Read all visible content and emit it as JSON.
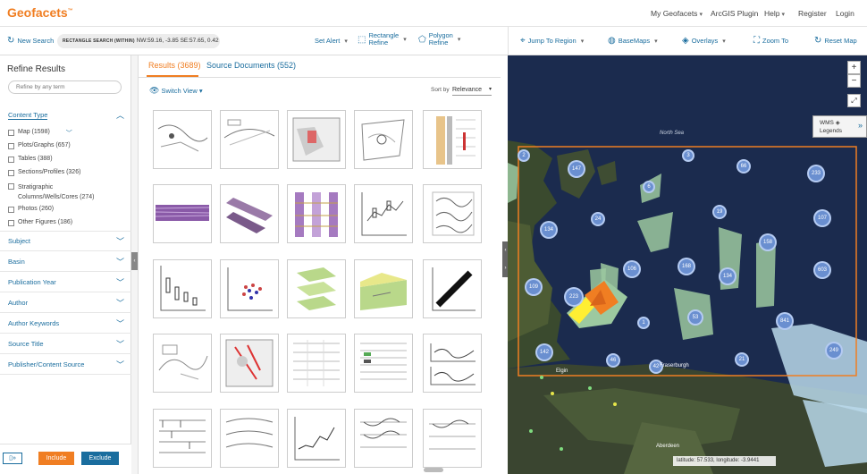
{
  "topbar": {
    "logo": "Geofacets",
    "logo_tm": "™",
    "my_geofacets": "My Geofacets",
    "arcgis": "ArcGIS Plugin",
    "help": "Help",
    "register": "Register",
    "login": "Login"
  },
  "toolbar": {
    "new_search": "New Search",
    "coord_prefix": "RECTANGLE SEARCH (WITHIN)",
    "coord_value": "NW:59.16, -3.85 SE:57.65, 0.42",
    "set_alert": "Set Alert",
    "rect_refine_1": "Rectangle",
    "rect_refine_2": "Refine",
    "poly_refine_1": "Polygon",
    "poly_refine_2": "Refine",
    "jump_region": "Jump To Region",
    "basemaps": "BaseMaps",
    "overlays": "Overlays",
    "zoom_to": "Zoom To",
    "reset_map": "Reset Map"
  },
  "refine": {
    "title": "Refine Results",
    "search_placeholder": "Refine by any term",
    "content_type": "Content Type",
    "facets": [
      "Map (1598)",
      "Plots/Graphs (657)",
      "Tables (388)",
      "Sections/Profiles (326)",
      "Stratigraphic",
      "Columns/Wells/Cores (274)",
      "Photos (260)",
      "Other Figures (186)"
    ],
    "sections": [
      "Subject",
      "Basin",
      "Publication Year",
      "Author",
      "Author Keywords",
      "Source Title",
      "Publisher/Content Source"
    ],
    "include": "Include",
    "exclude": "Exclude"
  },
  "results": {
    "tab_results": "Results (3689)",
    "tab_source": "Source Documents (552)",
    "switch_view": "Switch View",
    "sort_by": "Sort by",
    "sort_value": "Relevance"
  },
  "map": {
    "wms_1": "WMS",
    "wms_2": "Legends",
    "north_sea": "North Sea",
    "fraserburgh": "Fraserburgh",
    "elgin": "Elgin",
    "aberdeen": "Aberdeen",
    "latlon": "latitude: 57.533, longitude: -3.9441",
    "clusters": [
      "2",
      "147",
      "3",
      "66",
      "233",
      "6",
      "24",
      "19",
      "107",
      "134",
      "158",
      "106",
      "168",
      "134",
      "603",
      "109",
      "223",
      "53",
      "841",
      "1",
      "142",
      "46",
      "42",
      "21",
      "249"
    ]
  },
  "colors": {
    "accent": "#f07e22",
    "link": "#1a6d9e",
    "include": "#f07e22",
    "exclude": "#1a6d9e",
    "map_sea": "#1b2b4e",
    "cluster": "#6a8fd0"
  }
}
